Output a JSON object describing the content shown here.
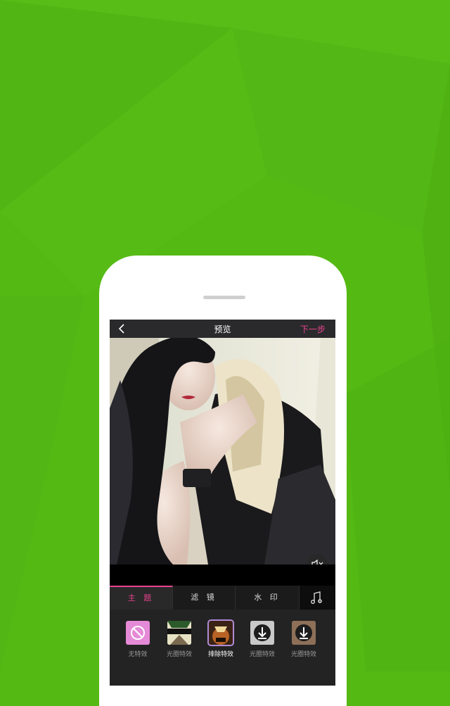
{
  "colors": {
    "background": "#55b914",
    "accent": "#e9438e",
    "topbar": "#2a2a2c"
  },
  "topbar": {
    "title": "预览",
    "next_label": "下一步",
    "back_icon": "chevron-left-icon"
  },
  "preview": {
    "mute_icon": "speaker-muted-icon"
  },
  "tabs": [
    {
      "label": "主 题",
      "active": true
    },
    {
      "label": "滤 镜",
      "active": false
    },
    {
      "label": "水 印",
      "active": false
    }
  ],
  "music_icon": "music-note-plus-icon",
  "effects": [
    {
      "label": "无特效",
      "icon": "prohibited-icon",
      "selected": false
    },
    {
      "label": "光圈特效",
      "icon": "effect-thumbnail",
      "selected": false
    },
    {
      "label": "排除特效",
      "icon": "effect-thumbnail",
      "selected": true
    },
    {
      "label": "光圈特效",
      "icon": "effect-thumbnail",
      "selected": false
    },
    {
      "label": "光圈特效",
      "icon": "effect-thumbnail",
      "selected": false
    }
  ]
}
